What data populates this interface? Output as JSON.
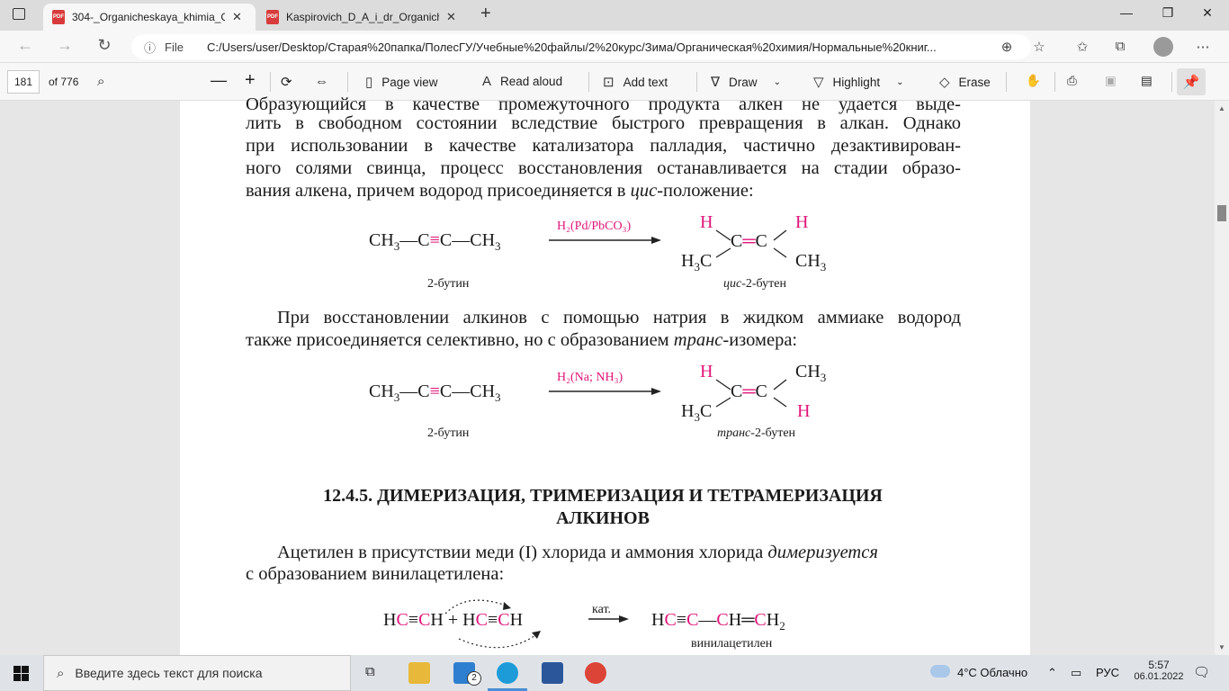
{
  "tabs": [
    {
      "title": "304-_Organicheskaya_khimia_Ch",
      "active": true
    },
    {
      "title": "Kaspirovich_D_A_i_dr_Organiche",
      "active": false
    }
  ],
  "address": {
    "file_label": "File",
    "url": "C:/Users/user/Desktop/Старая%20папка/ПолесГУ/Учебные%20файлы/2%20курс/Зима/Органическая%20химия/Нормальные%20книг..."
  },
  "pdf_toolbar": {
    "page_number": "181",
    "page_total": "of 776",
    "page_view": "Page view",
    "read_aloud": "Read aloud",
    "add_text": "Add text",
    "draw": "Draw",
    "highlight": "Highlight",
    "erase": "Erase"
  },
  "document": {
    "para1": [
      "Образующийся в качестве промежуточного продукта алкен не удается выде-",
      "лить в свободном состоянии вследствие быстрого превращения в алкан. Однако",
      "при использовании в качестве катализатора палладия, частично дезактивирован-",
      "ного солями свинца, процесс восстановления останавливается на стадии образо-"
    ],
    "para1_last_pre": "вания алкена, причем водород присоединяется в ",
    "para1_last_em": "цис",
    "para1_last_post": "-положение:",
    "r1": {
      "reagent": "H₂(Pd/PbCO₃)",
      "left_caption": "2-бутин",
      "right_caption_em": "цис",
      "right_caption_rest": "-2-бутен"
    },
    "para2_line1": "При восстановлении алкинов с помощью натрия в жидком аммиаке водород",
    "para2_line2_pre": "также присоединяется селективно, но с образованием ",
    "para2_line2_em": "транс",
    "para2_line2_post": "-изомера:",
    "r2": {
      "reagent": "H₂(Na; NH₃)",
      "left_caption": "2-бутин",
      "right_caption_em": "транс",
      "right_caption_rest": "-2-бутен"
    },
    "heading_line1": "12.4.5. ДИМЕРИЗАЦИЯ, ТРИМЕРИЗАЦИЯ И ТЕТРАМЕРИЗАЦИЯ",
    "heading_line2": "АЛКИНОВ",
    "para3_line1_pre": "Ацетилен в присутствии меди (I) хлорида и аммония хлорида ",
    "para3_line1_em": "димеризуется",
    "para3_line2": "с образованием винилацетилена:",
    "r3": {
      "reagent": "кат.",
      "product_caption": "винилацетилен"
    }
  },
  "taskbar": {
    "search_placeholder": "Введите здесь текст для поиска",
    "weather": "4°C  Облачно",
    "lang": "РУС",
    "time": "5:57",
    "date": "06.01.2022",
    "mail_badge": "2"
  }
}
